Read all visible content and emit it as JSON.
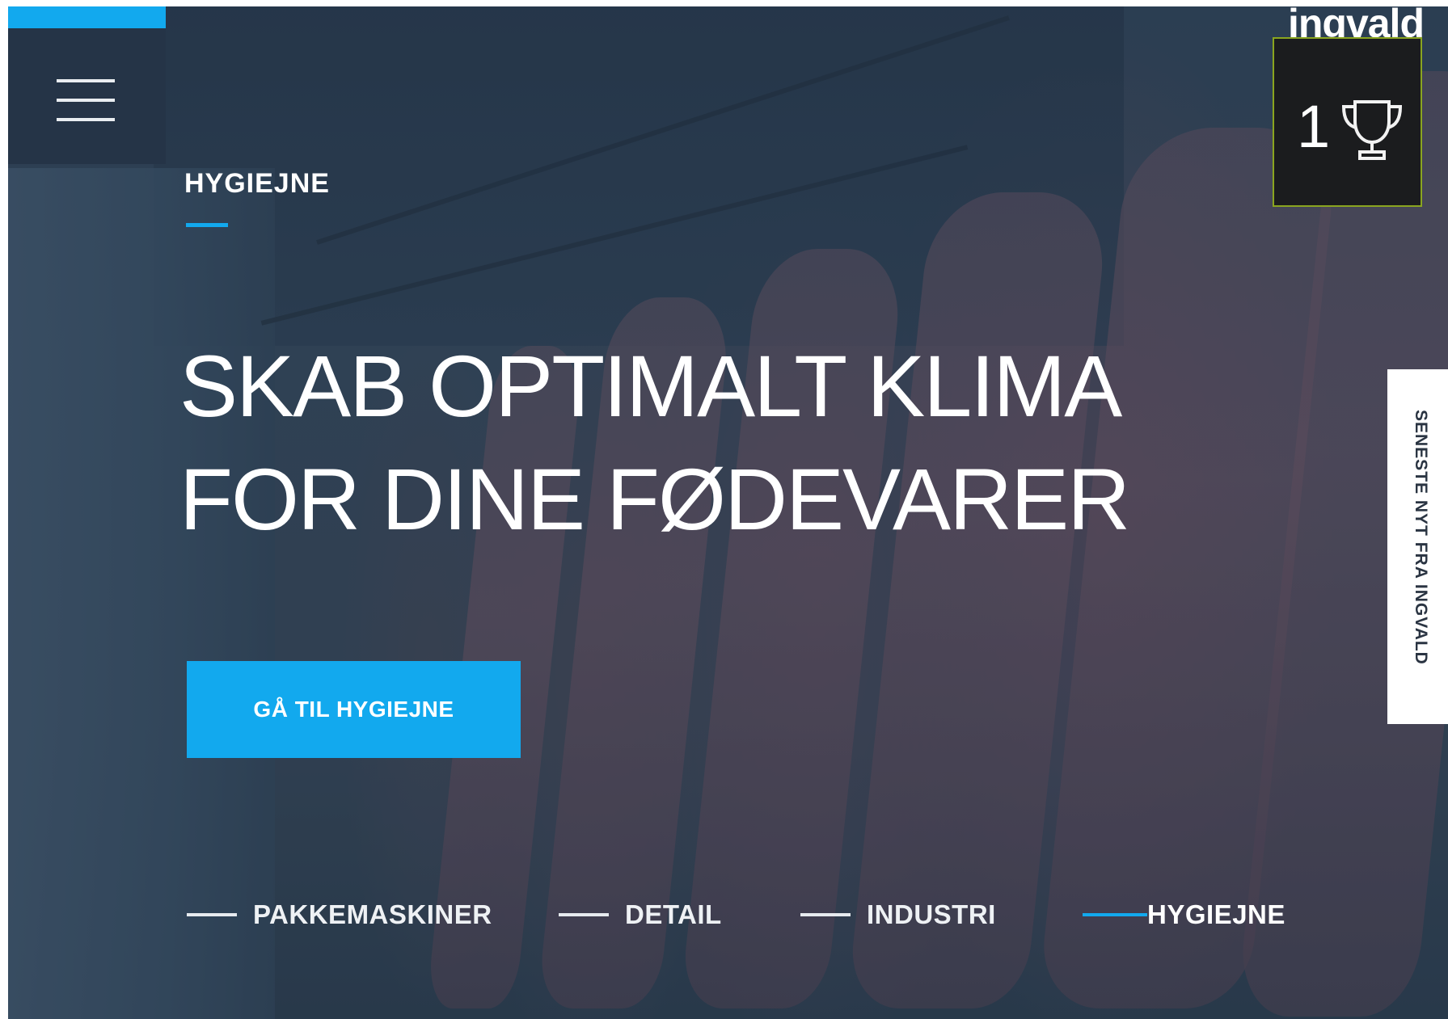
{
  "brand": {
    "logo_text": "ingvald"
  },
  "award": {
    "rank": "1",
    "icon": "trophy-icon"
  },
  "menu": {
    "icon": "hamburger-menu-icon"
  },
  "hero": {
    "eyebrow": "HYGIEJNE",
    "headline_line1": "SKAB OPTIMALT KLIMA",
    "headline_line2": "FOR DINE FØDEVARER",
    "cta_label": "GÅ TIL HYGIEJNE"
  },
  "slider_nav": {
    "items": [
      {
        "label": "PAKKEMASKINER",
        "active": false
      },
      {
        "label": "DETAIL",
        "active": false
      },
      {
        "label": "INDUSTRI",
        "active": false
      },
      {
        "label": "HYGIEJNE",
        "active": true
      }
    ]
  },
  "news_tab": {
    "label": "SENESTE NYT FRA INGVALD"
  },
  "colors": {
    "accent": "#12a9ee",
    "menu_bg": "#253447",
    "badge_border": "#8aa51f"
  }
}
